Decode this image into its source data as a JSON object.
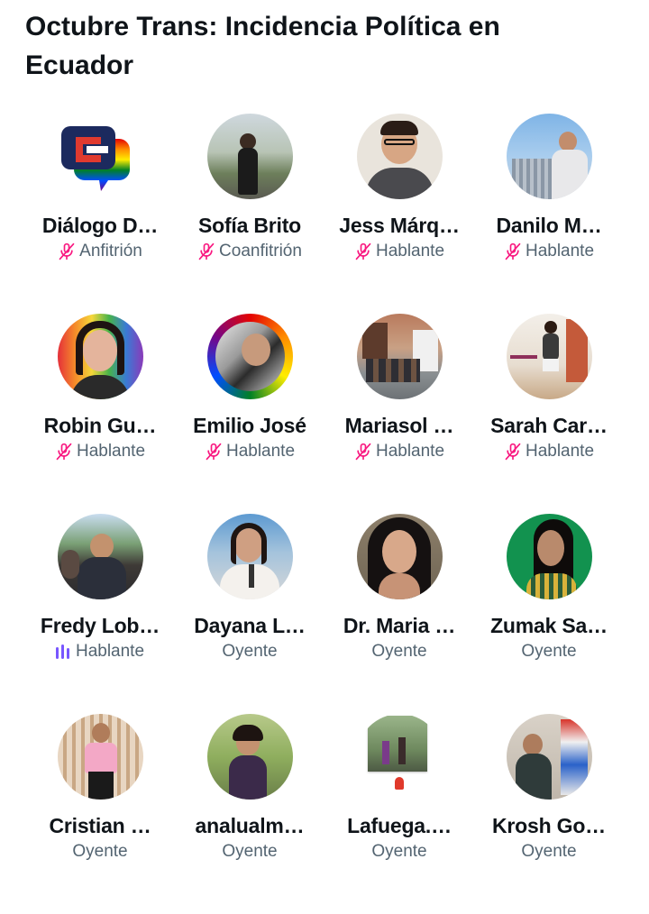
{
  "space": {
    "title": "Octubre Trans: Incidencia Política en Ecuador"
  },
  "colors": {
    "muted_mic": "#f91880",
    "speaking": "#7856ff",
    "secondary_text": "#536471"
  },
  "participants": [
    {
      "name": "Diálogo D…",
      "role": "Anfitrión",
      "mic": "muted",
      "avatar": "dialogo-logo"
    },
    {
      "name": "Sofía Brito",
      "role": "Coanfitrión",
      "mic": "muted",
      "avatar": "photo"
    },
    {
      "name": "Jess Márq…",
      "role": "Hablante",
      "mic": "muted",
      "avatar": "photo"
    },
    {
      "name": "Danilo M…",
      "role": "Hablante",
      "mic": "muted",
      "avatar": "photo"
    },
    {
      "name": "Robin Gu…",
      "role": "Hablante",
      "mic": "muted",
      "avatar": "photo"
    },
    {
      "name": "Emilio José",
      "role": "Hablante",
      "mic": "muted",
      "avatar": "photo"
    },
    {
      "name": "Mariasol …",
      "role": "Hablante",
      "mic": "muted",
      "avatar": "photo"
    },
    {
      "name": "Sarah Car…",
      "role": "Hablante",
      "mic": "muted",
      "avatar": "photo"
    },
    {
      "name": "Fredy Lob…",
      "role": "Hablante",
      "mic": "speaking",
      "avatar": "photo"
    },
    {
      "name": "Dayana L…",
      "role": "Oyente",
      "mic": "none",
      "avatar": "photo"
    },
    {
      "name": "Dr. Maria …",
      "role": "Oyente",
      "mic": "none",
      "avatar": "photo"
    },
    {
      "name": "Zumak Sa…",
      "role": "Oyente",
      "mic": "none",
      "avatar": "photo"
    },
    {
      "name": "Cristian …",
      "role": "Oyente",
      "mic": "none",
      "avatar": "photo"
    },
    {
      "name": "analualm…",
      "role": "Oyente",
      "mic": "none",
      "avatar": "photo"
    },
    {
      "name": "Lafuega.…",
      "role": "Oyente",
      "mic": "none",
      "avatar": "photo"
    },
    {
      "name": "Krosh Go…",
      "role": "Oyente",
      "mic": "none",
      "avatar": "photo"
    }
  ]
}
